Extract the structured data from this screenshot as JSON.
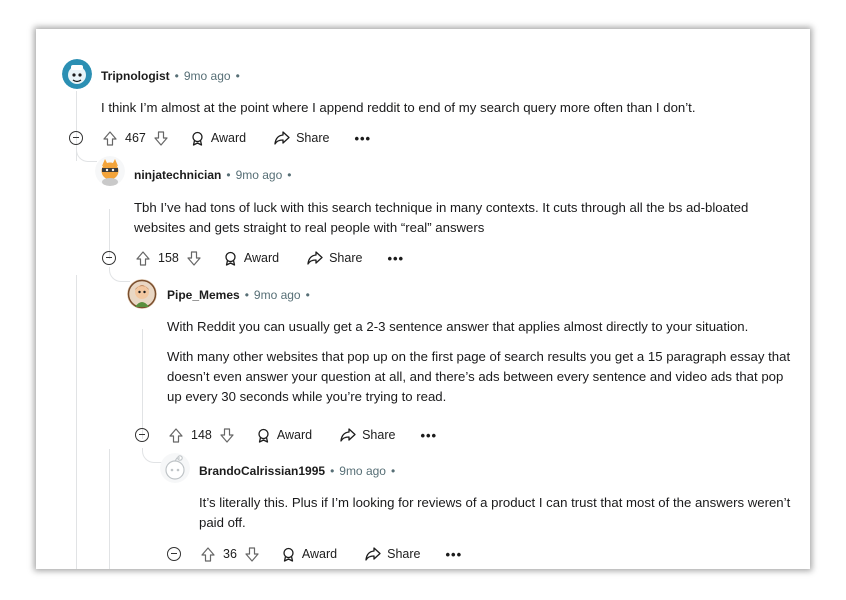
{
  "comments": [
    {
      "username": "Tripnologist",
      "time": "9mo ago",
      "body": [
        "I think I’m almost at the point where I append reddit to end of my search query more often than I don’t."
      ],
      "votes": "467",
      "award_label": "Award",
      "share_label": "Share",
      "more_label": "•••",
      "avatar_color": "#3aa7c9"
    },
    {
      "username": "ninjatechnician",
      "time": "9mo ago",
      "body": [
        "Tbh I’ve had tons of luck with this search technique in many contexts. It cuts through all the bs ad-bloated websites and gets straight to real people with “real” answers"
      ],
      "votes": "158",
      "award_label": "Award",
      "share_label": "Share",
      "more_label": "•••",
      "avatar_color": "#f3a43b"
    },
    {
      "username": "Pipe_Memes",
      "time": "9mo ago",
      "body": [
        "With Reddit you can usually get a 2-3 sentence answer that applies almost directly to your situation.",
        "With many other websites that pop up on the first page of search results you get a 15 paragraph essay that doesn’t even answer your question at all, and there’s ads between every sentence and video ads that pop up every 30 seconds while you’re trying to read."
      ],
      "votes": "148",
      "award_label": "Award",
      "share_label": "Share",
      "more_label": "•••",
      "avatar_color": "#c97b4a"
    },
    {
      "username": "BrandoCalrissian1995",
      "time": "9mo ago",
      "body": [
        "It’s literally this. Plus if I’m looking for reviews of a product I can trust that most of the answers weren’t paid off."
      ],
      "votes": "36",
      "award_label": "Award",
      "share_label": "Share",
      "more_label": "•••",
      "avatar_color": "#d7dadc"
    }
  ]
}
